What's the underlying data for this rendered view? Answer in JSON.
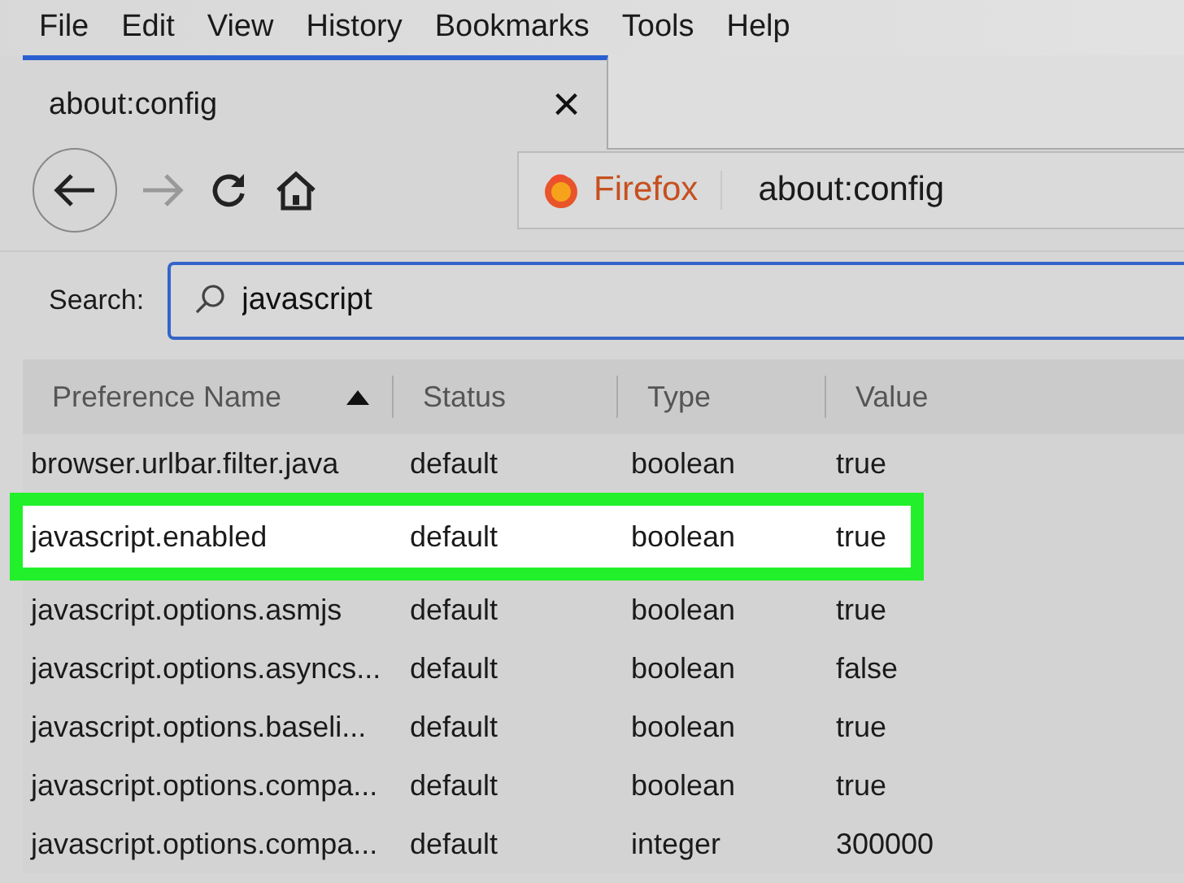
{
  "menu_bar": [
    "File",
    "Edit",
    "View",
    "History",
    "Bookmarks",
    "Tools",
    "Help"
  ],
  "tab": {
    "title": "about:config",
    "close": "×"
  },
  "toolbar": {
    "identity": "Firefox",
    "address": "about:config"
  },
  "search": {
    "label": "Search:",
    "value": "javascript"
  },
  "table": {
    "columns": [
      {
        "label": "Preference Name",
        "sorted": true
      },
      {
        "label": "Status",
        "sorted": false
      },
      {
        "label": "Type",
        "sorted": false
      },
      {
        "label": "Value",
        "sorted": false
      }
    ],
    "rows": [
      {
        "cells": [
          "browser.urlbar.filter.java",
          "default",
          "boolean",
          "true"
        ],
        "selected": false
      },
      {
        "cells": [
          "javascript.enabled",
          "default",
          "boolean",
          "true"
        ],
        "selected": true
      },
      {
        "cells": [
          "javascript.options.asmjs",
          "default",
          "boolean",
          "true"
        ],
        "selected": false
      },
      {
        "cells": [
          "javascript.options.asyncs...",
          "default",
          "boolean",
          "false"
        ],
        "selected": false
      },
      {
        "cells": [
          "javascript.options.baseli...",
          "default",
          "boolean",
          "true"
        ],
        "selected": false
      },
      {
        "cells": [
          "javascript.options.compa...",
          "default",
          "boolean",
          "true"
        ],
        "selected": false
      },
      {
        "cells": [
          "javascript.options.compa...",
          "default",
          "integer",
          "300000"
        ],
        "selected": false
      }
    ]
  }
}
